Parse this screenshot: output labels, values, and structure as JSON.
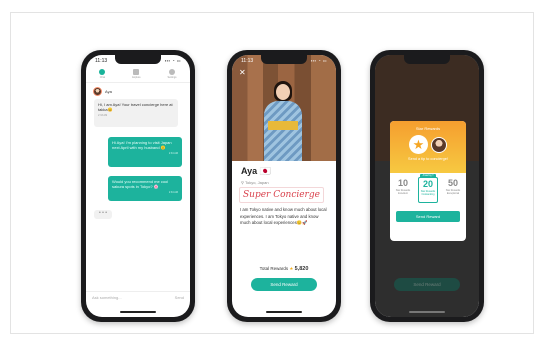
{
  "chat": {
    "status_time": "11:13",
    "status_signal": "▪▪▪ ◔ ▭",
    "tabs": [
      {
        "label": "Chat"
      },
      {
        "label": "Explore"
      },
      {
        "label": "Settings"
      }
    ],
    "header_name": "Aya",
    "messages": [
      {
        "text": "Hi, I am Aya! Your travel concierge here at takka😊",
        "time": "2:33 AM"
      },
      {
        "text": "Hi Aya! I'm planning to visit Japan next April with my husband 🙂",
        "time": "2:34 AM"
      },
      {
        "text": "Would you recommend me cool sakura spots in Tokyo? 🌸",
        "time": "2:34 AM"
      }
    ],
    "typing": "• • •",
    "input_placeholder": "Ask something...",
    "send_label": "Send"
  },
  "profile": {
    "status_time": "11:13",
    "status_signal": "▪▪▪ ◔ ▭",
    "close_glyph": "✕",
    "name": "Aya 🇯🇵",
    "location": "⚲ Tokyo, Japan",
    "badge": "Super Concierge",
    "bio": "I am Tokyo native and know much about local experiences. I am Tokyo native and know much about local experiences😊🚀",
    "rewards_label": "Total Rewards",
    "rewards_star": "★",
    "rewards_value": "5,820",
    "send_button": "Send  Reward"
  },
  "reward_modal": {
    "title": "Star Rewards",
    "star_glyph": "★",
    "subtitle": "Send a tip to concierge!",
    "amounts": [
      {
        "value": "10",
        "label": "Star Rewards",
        "sub": "Excellent"
      },
      {
        "value": "20",
        "label": "Star Rewards",
        "sub": "Outstanding",
        "tag": "Amazing !!"
      },
      {
        "value": "50",
        "label": "Star Rewards",
        "sub": "Exceptional"
      }
    ],
    "send_button": "Send Reward",
    "background_send": "Send Reward"
  },
  "colors": {
    "teal": "#1db39d",
    "orange": "#f59e2f",
    "yellow": "#f7c941",
    "pink": "#d9424d"
  }
}
